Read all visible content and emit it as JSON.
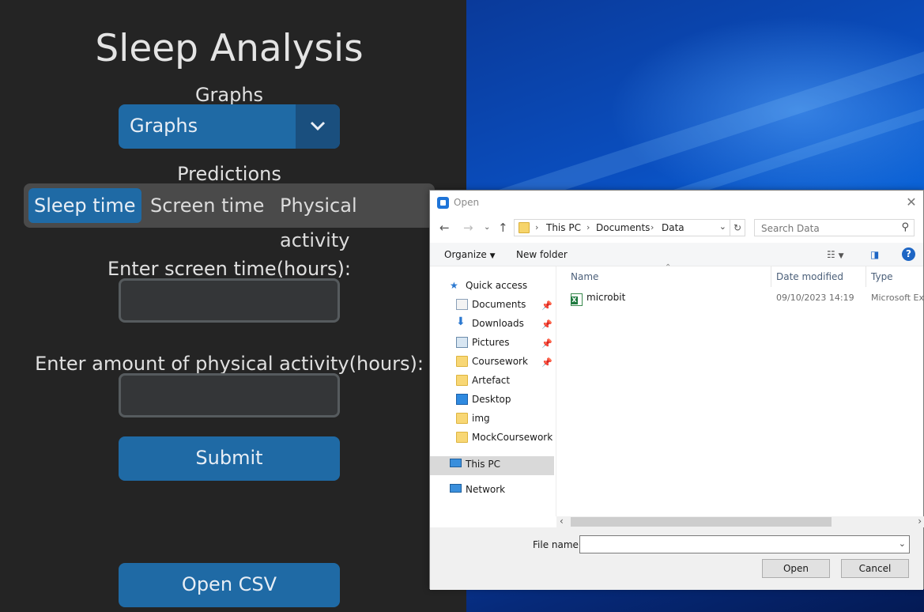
{
  "app": {
    "title": "Sleep Analysis",
    "graphs_label": "Graphs",
    "graphs_selected": "Graphs",
    "predictions_label": "Predictions",
    "prediction_options": [
      "Sleep time",
      "Screen time",
      "Physical activity"
    ],
    "prediction_selected": "Sleep time",
    "screen_time_label": "Enter screen time(hours):",
    "screen_time_value": "",
    "activity_label": "Enter amount of physical activity(hours):",
    "activity_value": "",
    "submit_label": "Submit",
    "open_csv_label": "Open CSV",
    "accent_color": "#1f6aa5"
  },
  "dialog": {
    "title": "Open",
    "breadcrumb": [
      "This PC",
      "Documents",
      "Data"
    ],
    "search_placeholder": "Search Data",
    "organize_label": "Organize",
    "new_folder_label": "New folder",
    "help_label": "?",
    "nav": {
      "quick_access": "Quick access",
      "items": [
        "Documents",
        "Downloads",
        "Pictures",
        "Coursework",
        "Artefact",
        "Desktop",
        "img",
        "MockCoursework"
      ],
      "this_pc": "This PC",
      "network": "Network"
    },
    "columns": {
      "name": "Name",
      "date_modified": "Date modified",
      "type": "Type"
    },
    "files": [
      {
        "name": "microbit",
        "date_modified": "09/10/2023 14:19",
        "type": "Microsoft Ex",
        "icon": "excel-file-icon"
      }
    ],
    "file_name_label": "File name:",
    "file_name_value": "",
    "open_label": "Open",
    "cancel_label": "Cancel"
  }
}
